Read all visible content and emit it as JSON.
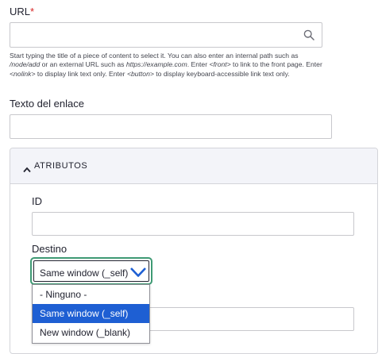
{
  "url_field": {
    "label": "URL",
    "required_marker": "*",
    "value": "",
    "placeholder": "",
    "help_parts": {
      "p1": "Start typing the title of a piece of content to select it. You can also enter an internal path such as ",
      "p2": "/node/add",
      "p3": " or an external URL such as ",
      "p4": "https://example.com",
      "p5": ". Enter ",
      "p6": "<front>",
      "p7": " to link to the front page. Enter ",
      "p8": "<nolink>",
      "p9": " to display link text only. Enter ",
      "p10": "<button>",
      "p11": " to display keyboard-accessible link text only."
    }
  },
  "link_text_field": {
    "label": "Texto del enlace",
    "value": ""
  },
  "attributes_panel": {
    "title": "ATRIBUTOS",
    "expanded": true,
    "id_field": {
      "label": "ID",
      "value": ""
    },
    "target_field": {
      "label": "Destino",
      "selected": "Same window (_self)",
      "options": [
        {
          "label": "- Ninguno -",
          "selected": false
        },
        {
          "label": "Same window (_self)",
          "selected": true
        },
        {
          "label": "New window (_blank)",
          "selected": false
        }
      ]
    },
    "hidden_field_value": ""
  },
  "colors": {
    "focus_ring": "#3f9a74",
    "selection": "#1e5fd3",
    "required": "#d72222",
    "chevron": "#1e5fd3"
  },
  "icons": {
    "search": "search-icon",
    "chevron_up": "chevron-up-icon",
    "chevron_down": "chevron-down-icon"
  }
}
